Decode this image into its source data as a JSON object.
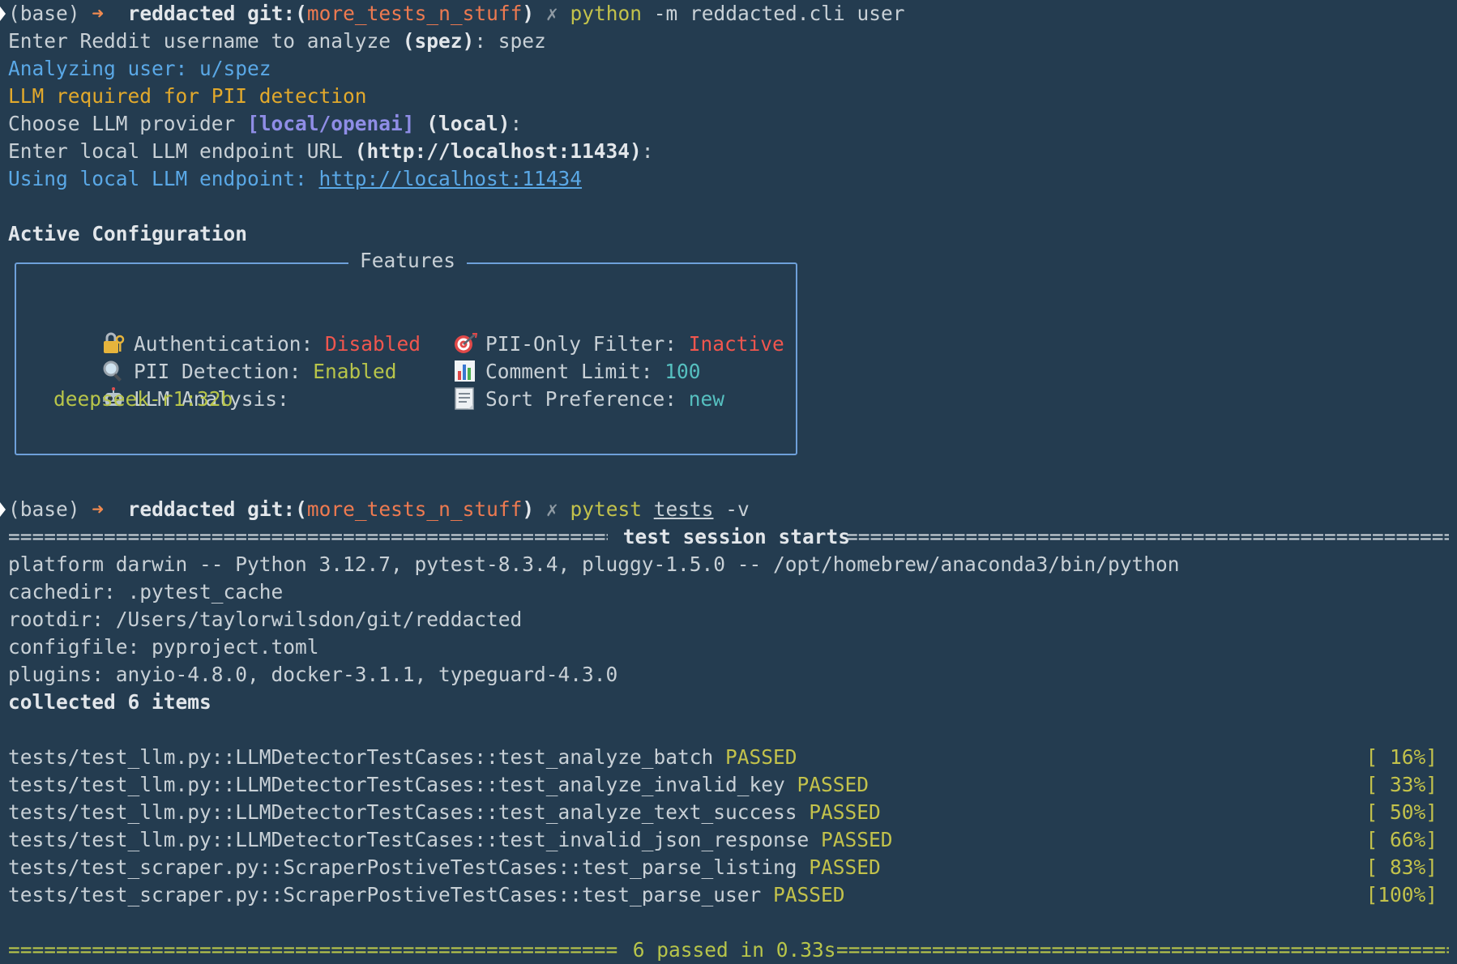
{
  "prompt1": {
    "env": "(base)",
    "arrow": "➜",
    "dir": "reddacted",
    "git_label": "git:(",
    "branch": "more_tests_n_stuff",
    "git_close": ")",
    "dirty": "✗",
    "cmd": "python",
    "args": "-m reddacted.cli user"
  },
  "cli": {
    "enter_user_prefix": "Enter Reddit username to analyze ",
    "enter_user_default": "(spez)",
    "enter_user_suffix": ": spez",
    "analyzing": "Analyzing user: u/spez",
    "llm_required": "LLM required for PII detection",
    "choose_prefix": "Choose LLM provider ",
    "choose_options": "[local/openai]",
    "choose_default": " (local)",
    "choose_suffix": ":",
    "endpoint_prefix": "Enter local LLM endpoint URL ",
    "endpoint_default": "(http://localhost:11434)",
    "endpoint_suffix": ":",
    "using_prefix": "Using local LLM endpoint: ",
    "using_url": "http://localhost:11434",
    "active_config": "Active Configuration"
  },
  "panel": {
    "title": "Features",
    "auth_label": "Authentication: ",
    "auth_value": "Disabled",
    "pii_label": "PII Detection: ",
    "pii_value": "Enabled",
    "llm_label": "LLM Analysis:",
    "llm_value": "deepseek-r1:32b",
    "filter_label": "PII-Only Filter: ",
    "filter_value": "Inactive",
    "limit_label": "Comment Limit: ",
    "limit_value": "100",
    "sort_label": "Sort Preference: ",
    "sort_value": "new",
    "icons": [
      "lock-key-icon",
      "magnifier-icon",
      "robot-icon",
      "target-icon",
      "bar-chart-icon",
      "document-icon"
    ]
  },
  "prompt2": {
    "env": "(base)",
    "arrow": "➜",
    "dir": "reddacted",
    "git_label": "git:(",
    "branch": "more_tests_n_stuff",
    "git_close": ")",
    "dirty": "✗",
    "cmd": "pytest",
    "arg_path": "tests",
    "arg_flag": "-v"
  },
  "pytest": {
    "session_header": " test session starts ",
    "platform": "platform darwin -- Python 3.12.7, pytest-8.3.4, pluggy-1.5.0 -- /opt/homebrew/anaconda3/bin/python",
    "cachedir": "cachedir: .pytest_cache",
    "rootdir": "rootdir: /Users/taylorwilsdon/git/reddacted",
    "configfile": "configfile: pyproject.toml",
    "plugins": "plugins: anyio-4.8.0, docker-3.1.1, typeguard-4.3.0",
    "collected": "collected 6 items",
    "tests": [
      {
        "name": "tests/test_llm.py::LLMDetectorTestCases::test_analyze_batch ",
        "status": "PASSED",
        "pct": "[ 16%]"
      },
      {
        "name": "tests/test_llm.py::LLMDetectorTestCases::test_analyze_invalid_key ",
        "status": "PASSED",
        "pct": "[ 33%]"
      },
      {
        "name": "tests/test_llm.py::LLMDetectorTestCases::test_analyze_text_success ",
        "status": "PASSED",
        "pct": "[ 50%]"
      },
      {
        "name": "tests/test_llm.py::LLMDetectorTestCases::test_invalid_json_response ",
        "status": "PASSED",
        "pct": "[ 66%]"
      },
      {
        "name": "tests/test_scraper.py::ScraperPostiveTestCases::test_parse_listing ",
        "status": "PASSED",
        "pct": "[ 83%]"
      },
      {
        "name": "tests/test_scraper.py::ScraperPostiveTestCases::test_parse_user ",
        "status": "PASSED",
        "pct": "[100%]"
      }
    ],
    "summary": " 6 passed in 0.33s "
  },
  "colors": {
    "background": "#243c50",
    "panel_border": "#6ea0da",
    "passed": "#c3c24b",
    "error": "#f0564e",
    "info": "#5aa8e6",
    "warning": "#e2a92c"
  }
}
